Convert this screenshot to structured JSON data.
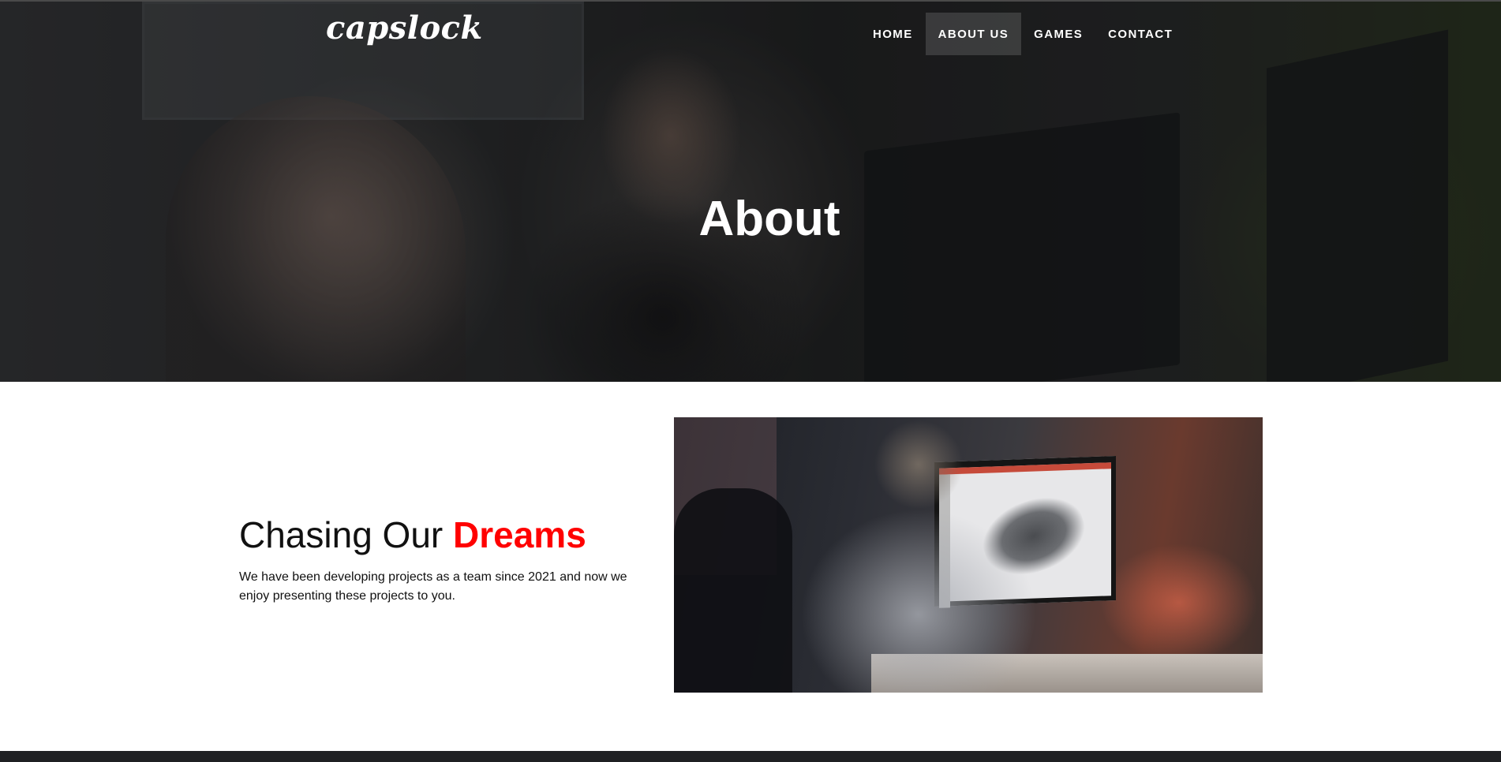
{
  "brand": {
    "logo_text": "capslock"
  },
  "nav": {
    "items": [
      {
        "label": "HOME",
        "active": false
      },
      {
        "label": "ABOUT US",
        "active": true
      },
      {
        "label": "GAMES",
        "active": false
      },
      {
        "label": "CONTACT",
        "active": false
      }
    ]
  },
  "hero": {
    "title": "About"
  },
  "section": {
    "headline_prefix": "Chasing Our ",
    "headline_accent": "Dreams",
    "paragraph": "We have been developing projects as a team since 2021 and now we enjoy presenting these projects to you."
  },
  "colors": {
    "accent": "#ff0000",
    "text": "#111111",
    "nav_text": "#ffffff",
    "footer": "#1f2023"
  }
}
